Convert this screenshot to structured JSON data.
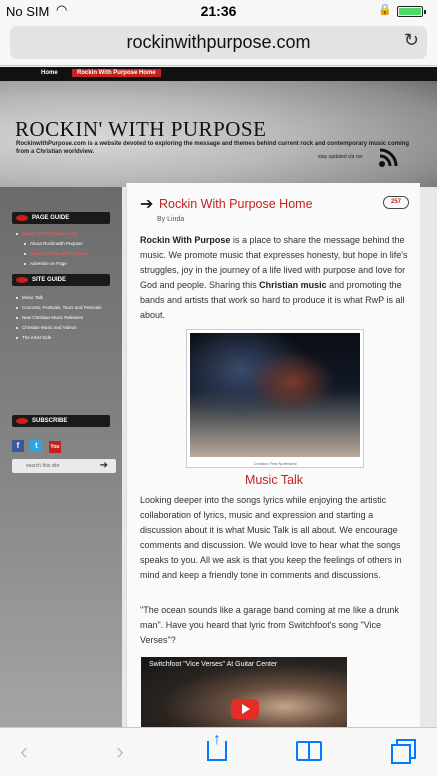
{
  "status_bar": {
    "carrier": "No SIM",
    "time": "21:36"
  },
  "browser": {
    "url": "rockinwithpurpose.com",
    "reload_icon": "reload-icon"
  },
  "site": {
    "nav": [
      "Home",
      "Rockin With Purpose Home"
    ],
    "title": "ROCKIN' WITH PURPOSE",
    "description": "RockinwithPurpose.com is a website devoted to exploring the message and themes behind current rock and contemporary music coming from a Christian worldview.",
    "stay_updated": "stay updated via rss"
  },
  "sidebar": {
    "page_guide_title": "PAGE GUIDE",
    "page_guide_items": [
      "Rockin With Purpose Home",
      "About Rockinwith Purpose",
      "Contact Rockin with Purpose",
      "Advertise on Page"
    ],
    "site_guide_title": "SITE GUIDE",
    "site_guide_items": [
      "Music Talk",
      "Concerts, Festivals, Tours and Festivals",
      "New Christian Music Releases",
      "Christian Music and Videos",
      "The Artist Side"
    ],
    "subscribe_title": "SUBSCRIBE",
    "search_placeholder": "search this site"
  },
  "post": {
    "title": "Rockin With Purpose Home",
    "comments": "257",
    "byline": "By Linda",
    "intro_bold": "Rockin With Purpose",
    "intro_rest_1": " is a place to share the message behind the music. We promote music that expresses honesty, but hope in life's struggles, joy in the journey of a life lived with purpose and love for God and people.  Sharing this ",
    "intro_bold_2": "Christian music",
    "intro_rest_2": " and promoting the bands and artists that work so hard to produce it is what RwP is all about.",
    "photo_caption": "Creation Fest Northwest",
    "section_title": "Music Talk",
    "para_2": "Looking deeper into the songs lyrics while enjoying the artistic collaboration of lyrics, music and expression and starting a discussion about it is what Music Talk is all about. We encourage comments and discussion. We would love to hear what the songs speaks to you. All we ask is that you keep the feelings of others in mind and keep a friendly tone in comments and discussions.",
    "para_3": "\"The ocean sounds like a garage band coming at me like a drunk man\". Have you heard that lyric from Switchfoot's song \"Vice Verses\"?",
    "video_title": "Switchfoot \"Vice Verses\" At Guitar Center"
  }
}
